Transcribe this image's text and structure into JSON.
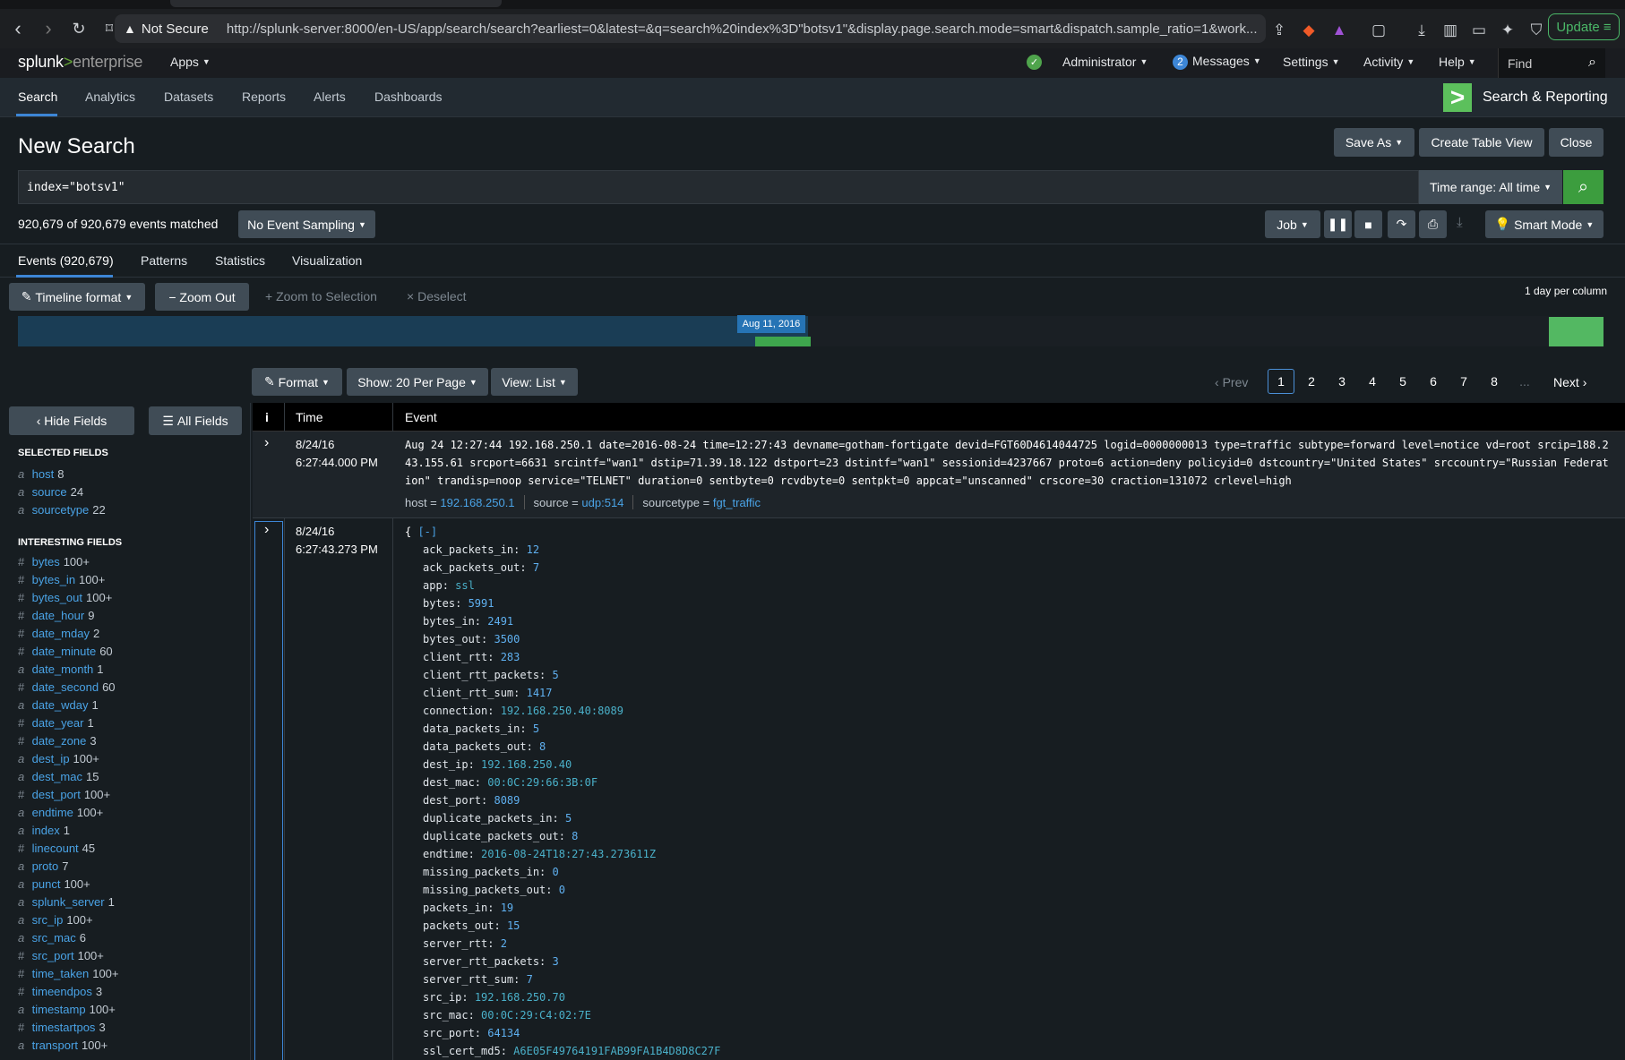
{
  "browser": {
    "not_secure": "Not Secure",
    "url": "http://splunk-server:8000/en-US/app/search/search?earliest=0&latest=&q=search%20index%3D\"botsv1\"&display.page.search.mode=smart&dispatch.sample_ratio=1&work...",
    "update_label": "Update"
  },
  "splunkbar": {
    "logo_splunk": "splunk",
    "logo_gt": ">",
    "logo_enterprise": "enterprise",
    "apps": "Apps",
    "administrator": "Administrator",
    "messages_count": "2",
    "messages": "Messages",
    "settings": "Settings",
    "activity": "Activity",
    "help": "Help",
    "find": "Find"
  },
  "appbar": {
    "nav": [
      "Search",
      "Analytics",
      "Datasets",
      "Reports",
      "Alerts",
      "Dashboards"
    ],
    "app_name": "Search & Reporting"
  },
  "search": {
    "title": "New Search",
    "save_as": "Save As",
    "create_table_view": "Create Table View",
    "close": "Close",
    "query": "index=\"botsv1\"",
    "time_range": "Time range: All time",
    "matched": "920,679 of 920,679 events matched",
    "sampling": "No Event Sampling",
    "job": "Job",
    "smart_mode": "Smart Mode"
  },
  "results_tabs": [
    "Events (920,679)",
    "Patterns",
    "Statistics",
    "Visualization"
  ],
  "timeline": {
    "format": "Timeline format",
    "zoom_out": "Zoom Out",
    "zoom_selection": "Zoom to Selection",
    "deselect": "Deselect",
    "per_column": "1 day per column",
    "tooltip": "Aug 11, 2016"
  },
  "pager_controls": {
    "format": "Format",
    "show": "Show: 20 Per Page",
    "view": "View: List",
    "prev": "Prev",
    "pages": [
      "1",
      "2",
      "3",
      "4",
      "5",
      "6",
      "7",
      "8"
    ],
    "ellipsis": "...",
    "next": "Next",
    "active_page": "1"
  },
  "sidebar": {
    "hide_fields": "Hide Fields",
    "all_fields": "All Fields",
    "selected_heading": "SELECTED FIELDS",
    "selected": [
      {
        "type": "a",
        "name": "host",
        "count": "8"
      },
      {
        "type": "a",
        "name": "source",
        "count": "24"
      },
      {
        "type": "a",
        "name": "sourcetype",
        "count": "22"
      }
    ],
    "interesting_heading": "INTERESTING FIELDS",
    "interesting": [
      {
        "type": "#",
        "name": "bytes",
        "count": "100+"
      },
      {
        "type": "#",
        "name": "bytes_in",
        "count": "100+"
      },
      {
        "type": "#",
        "name": "bytes_out",
        "count": "100+"
      },
      {
        "type": "#",
        "name": "date_hour",
        "count": "9"
      },
      {
        "type": "#",
        "name": "date_mday",
        "count": "2"
      },
      {
        "type": "#",
        "name": "date_minute",
        "count": "60"
      },
      {
        "type": "a",
        "name": "date_month",
        "count": "1"
      },
      {
        "type": "#",
        "name": "date_second",
        "count": "60"
      },
      {
        "type": "a",
        "name": "date_wday",
        "count": "1"
      },
      {
        "type": "#",
        "name": "date_year",
        "count": "1"
      },
      {
        "type": "#",
        "name": "date_zone",
        "count": "3"
      },
      {
        "type": "a",
        "name": "dest_ip",
        "count": "100+"
      },
      {
        "type": "a",
        "name": "dest_mac",
        "count": "15"
      },
      {
        "type": "#",
        "name": "dest_port",
        "count": "100+"
      },
      {
        "type": "a",
        "name": "endtime",
        "count": "100+"
      },
      {
        "type": "a",
        "name": "index",
        "count": "1"
      },
      {
        "type": "#",
        "name": "linecount",
        "count": "45"
      },
      {
        "type": "a",
        "name": "proto",
        "count": "7"
      },
      {
        "type": "a",
        "name": "punct",
        "count": "100+"
      },
      {
        "type": "a",
        "name": "splunk_server",
        "count": "1"
      },
      {
        "type": "a",
        "name": "src_ip",
        "count": "100+"
      },
      {
        "type": "a",
        "name": "src_mac",
        "count": "6"
      },
      {
        "type": "#",
        "name": "src_port",
        "count": "100+"
      },
      {
        "type": "#",
        "name": "time_taken",
        "count": "100+"
      },
      {
        "type": "#",
        "name": "timeendpos",
        "count": "3"
      },
      {
        "type": "a",
        "name": "timestamp",
        "count": "100+"
      },
      {
        "type": "#",
        "name": "timestartpos",
        "count": "3"
      },
      {
        "type": "a",
        "name": "transport",
        "count": "100+"
      }
    ]
  },
  "table": {
    "col_info": "i",
    "col_time": "Time",
    "col_event": "Event",
    "event1": {
      "date": "8/24/16",
      "time": "6:27:44.000 PM",
      "raw": "Aug 24 12:27:44 192.168.250.1 date=2016-08-24 time=12:27:43 devname=gotham-fortigate devid=FGT60D4614044725 logid=0000000013 type=traffic subtype=forward level=notice vd=root srcip=188.243.155.61 srcport=6631 srcintf=\"wan1\" dstip=71.39.18.122 dstport=23 dstintf=\"wan1\" sessionid=4237667 proto=6 action=deny policyid=0 dstcountry=\"United States\" srccountry=\"Russian Federation\" trandisp=noop service=\"TELNET\" duration=0 sentbyte=0 rcvdbyte=0 sentpkt=0 appcat=\"unscanned\" crscore=30 craction=131072 crlevel=high",
      "host_label": "host =",
      "host": "192.168.250.1",
      "source_label": "source =",
      "source": "udp:514",
      "sourcetype_label": "sourcetype =",
      "sourcetype": "fgt_traffic"
    },
    "event2": {
      "date": "8/24/16",
      "time": "6:27:43.273 PM",
      "open": "{ [-]",
      "fields": [
        {
          "k": "ack_packets_in",
          "v": "12"
        },
        {
          "k": "ack_packets_out",
          "v": "7"
        },
        {
          "k": "app",
          "v": "ssl"
        },
        {
          "k": "bytes",
          "v": "5991"
        },
        {
          "k": "bytes_in",
          "v": "2491"
        },
        {
          "k": "bytes_out",
          "v": "3500"
        },
        {
          "k": "client_rtt",
          "v": "283"
        },
        {
          "k": "client_rtt_packets",
          "v": "5"
        },
        {
          "k": "client_rtt_sum",
          "v": "1417"
        },
        {
          "k": "connection",
          "v": "192.168.250.40:8089"
        },
        {
          "k": "data_packets_in",
          "v": "5"
        },
        {
          "k": "data_packets_out",
          "v": "8"
        },
        {
          "k": "dest_ip",
          "v": "192.168.250.40"
        },
        {
          "k": "dest_mac",
          "v": "00:0C:29:66:3B:0F"
        },
        {
          "k": "dest_port",
          "v": "8089"
        },
        {
          "k": "duplicate_packets_in",
          "v": "5"
        },
        {
          "k": "duplicate_packets_out",
          "v": "8"
        },
        {
          "k": "endtime",
          "v": "2016-08-24T18:27:43.273611Z"
        },
        {
          "k": "missing_packets_in",
          "v": "0"
        },
        {
          "k": "missing_packets_out",
          "v": "0"
        },
        {
          "k": "packets_in",
          "v": "19"
        },
        {
          "k": "packets_out",
          "v": "15"
        },
        {
          "k": "server_rtt",
          "v": "2"
        },
        {
          "k": "server_rtt_packets",
          "v": "3"
        },
        {
          "k": "server_rtt_sum",
          "v": "7"
        },
        {
          "k": "src_ip",
          "v": "192.168.250.70"
        },
        {
          "k": "src_mac",
          "v": "00:0C:29:C4:02:7E"
        },
        {
          "k": "src_port",
          "v": "64134"
        },
        {
          "k": "ssl_cert_md5",
          "v": "A6E05F49764191FAB99FA1B4D8D8C27F"
        }
      ]
    }
  }
}
